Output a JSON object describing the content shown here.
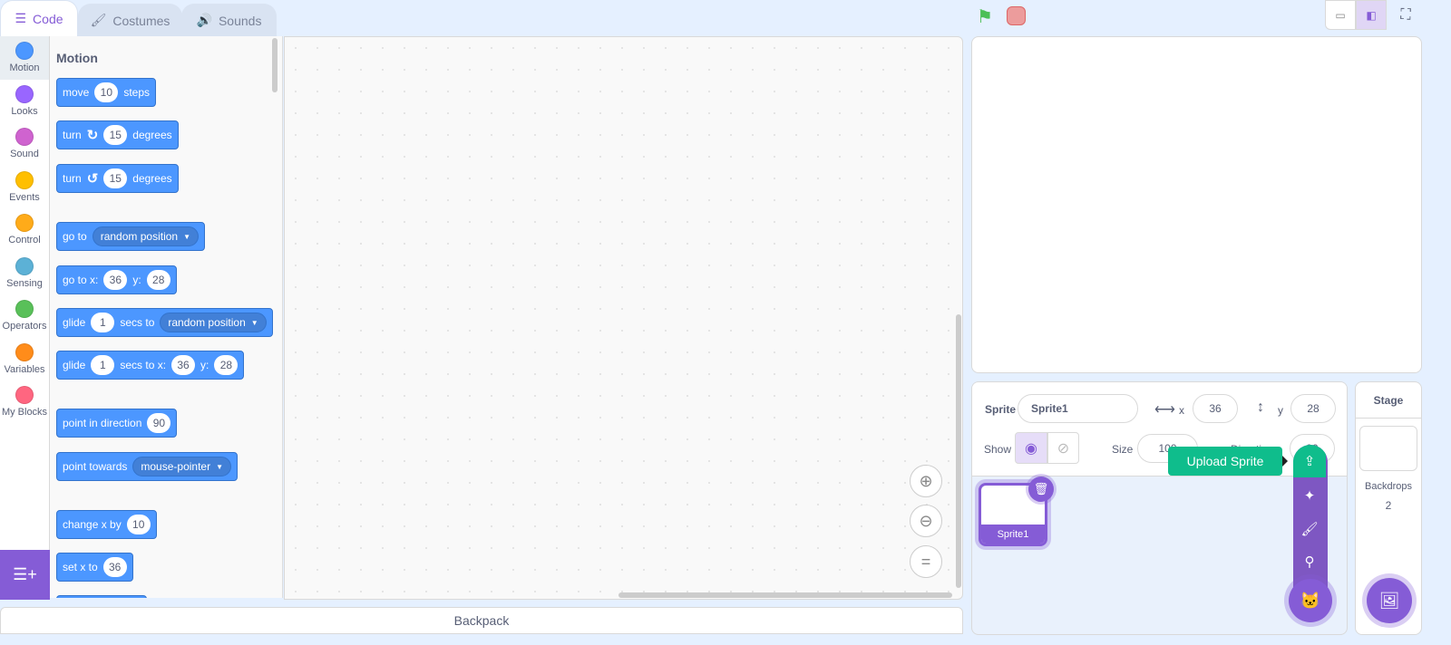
{
  "tabs": [
    {
      "label": "Code",
      "icon": "code-icon"
    },
    {
      "label": "Costumes",
      "icon": "brush-icon"
    },
    {
      "label": "Sounds",
      "icon": "speaker-icon"
    }
  ],
  "categories": [
    {
      "label": "Motion",
      "color": "#4c97ff"
    },
    {
      "label": "Looks",
      "color": "#9966ff"
    },
    {
      "label": "Sound",
      "color": "#cf63cf"
    },
    {
      "label": "Events",
      "color": "#ffbf00"
    },
    {
      "label": "Control",
      "color": "#ffab19"
    },
    {
      "label": "Sensing",
      "color": "#5cb1d6"
    },
    {
      "label": "Operators",
      "color": "#59c059"
    },
    {
      "label": "Variables",
      "color": "#ff8c1a"
    },
    {
      "label": "My Blocks",
      "color": "#ff6680"
    }
  ],
  "palette": {
    "heading": "Motion",
    "blocks": [
      {
        "parts": [
          {
            "t": "text",
            "v": "move"
          },
          {
            "t": "num",
            "v": "10"
          },
          {
            "t": "text",
            "v": "steps"
          }
        ]
      },
      {
        "parts": [
          {
            "t": "text",
            "v": "turn"
          },
          {
            "t": "icon",
            "v": "↻"
          },
          {
            "t": "num",
            "v": "15"
          },
          {
            "t": "text",
            "v": "degrees"
          }
        ]
      },
      {
        "parts": [
          {
            "t": "text",
            "v": "turn"
          },
          {
            "t": "icon",
            "v": "↺"
          },
          {
            "t": "num",
            "v": "15"
          },
          {
            "t": "text",
            "v": "degrees"
          }
        ]
      },
      {
        "parts": [
          {
            "t": "text",
            "v": "go to"
          },
          {
            "t": "drop",
            "v": "random position"
          }
        ]
      },
      {
        "parts": [
          {
            "t": "text",
            "v": "go to x:"
          },
          {
            "t": "num",
            "v": "36"
          },
          {
            "t": "text",
            "v": "y:"
          },
          {
            "t": "num",
            "v": "28"
          }
        ]
      },
      {
        "parts": [
          {
            "t": "text",
            "v": "glide"
          },
          {
            "t": "num",
            "v": "1"
          },
          {
            "t": "text",
            "v": "secs to"
          },
          {
            "t": "drop",
            "v": "random position"
          }
        ]
      },
      {
        "parts": [
          {
            "t": "text",
            "v": "glide"
          },
          {
            "t": "num",
            "v": "1"
          },
          {
            "t": "text",
            "v": "secs to x:"
          },
          {
            "t": "num",
            "v": "36"
          },
          {
            "t": "text",
            "v": "y:"
          },
          {
            "t": "num",
            "v": "28"
          }
        ]
      },
      {
        "parts": [
          {
            "t": "text",
            "v": "point in direction"
          },
          {
            "t": "num",
            "v": "90"
          }
        ]
      },
      {
        "parts": [
          {
            "t": "text",
            "v": "point towards"
          },
          {
            "t": "drop",
            "v": "mouse-pointer"
          }
        ]
      },
      {
        "parts": [
          {
            "t": "text",
            "v": "change x by"
          },
          {
            "t": "num",
            "v": "10"
          }
        ]
      },
      {
        "parts": [
          {
            "t": "text",
            "v": "set x to"
          },
          {
            "t": "num",
            "v": "36"
          }
        ]
      }
    ]
  },
  "backpack": "Backpack",
  "sprite_info": {
    "sprite_label": "Sprite",
    "sprite_name": "Sprite1",
    "x_label": "x",
    "x": "36",
    "y_label": "y",
    "y": "28",
    "show_label": "Show",
    "size_label": "Size",
    "size": "100",
    "direction_label": "Direction",
    "direction": "90"
  },
  "sprites": [
    {
      "name": "Sprite1"
    }
  ],
  "tooltip": "Upload Sprite",
  "stage_pane": {
    "title": "Stage",
    "backdrops_label": "Backdrops",
    "backdrops_count": "2"
  },
  "colors": {
    "accent": "#855cd6",
    "motion": "#4c97ff",
    "upload": "#0fbd8c"
  }
}
